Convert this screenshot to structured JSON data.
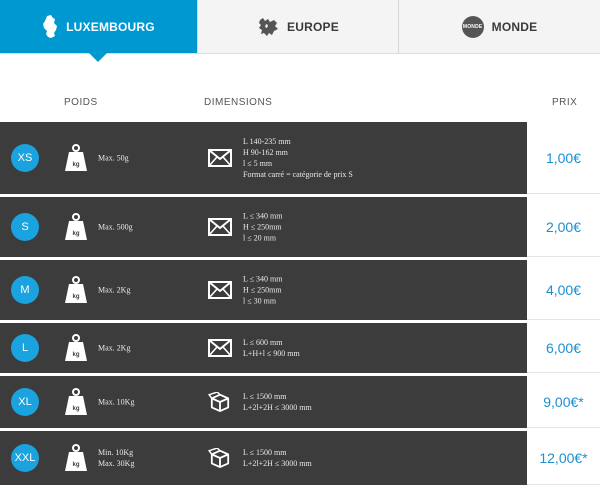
{
  "tabs": [
    {
      "label": "LUXEMBOURG",
      "active": true,
      "icon": "luxembourg-map-icon"
    },
    {
      "label": "EUROPE",
      "active": false,
      "icon": "europe-map-icon"
    },
    {
      "label": "MONDE",
      "active": false,
      "icon": "monde-badge-icon",
      "badge": "MONDE"
    }
  ],
  "columns": {
    "poids": "POIDS",
    "dimensions": "DIMENSIONS",
    "prix": "PRIX"
  },
  "weight_icon_text": "kg",
  "colors": {
    "accent": "#0098d1",
    "badge": "#1aa3de",
    "row_bg": "#3c3c3c",
    "price": "#1b8fd0"
  },
  "rows": [
    {
      "size": "XS",
      "weight": [
        "Max. 50g"
      ],
      "dim_icon": "envelope-icon",
      "dims": [
        "L 140-235 mm",
        "H 90-162 mm",
        "l ≤ 5 mm",
        "Format carré = catégorie de prix S"
      ],
      "price": "1,00€"
    },
    {
      "size": "S",
      "weight": [
        "Max. 500g"
      ],
      "dim_icon": "envelope-icon",
      "dims": [
        "L ≤ 340 mm",
        "H ≤ 250mm",
        "l ≤ 20 mm"
      ],
      "price": "2,00€"
    },
    {
      "size": "M",
      "weight": [
        "Max. 2Kg"
      ],
      "dim_icon": "envelope-icon",
      "dims": [
        "L ≤ 340 mm",
        "H ≤ 250mm",
        "l ≤ 30 mm"
      ],
      "price": "4,00€"
    },
    {
      "size": "L",
      "weight": [
        "Max. 2Kg"
      ],
      "dim_icon": "envelope-icon",
      "dims": [
        "L ≤ 600 mm",
        "L+H+l ≤ 900 mm"
      ],
      "price": "6,00€"
    },
    {
      "size": "XL",
      "weight": [
        "Max. 10Kg"
      ],
      "dim_icon": "package-icon",
      "dims": [
        "L ≤ 1500 mm",
        "L+2l+2H ≤ 3000 mm"
      ],
      "price": "9,00€*"
    },
    {
      "size": "XXL",
      "weight": [
        "Min. 10Kg",
        "Max. 30Kg"
      ],
      "dim_icon": "package-icon",
      "dims": [
        "L ≤ 1500 mm",
        "L+2l+2H ≤ 3000 mm"
      ],
      "price": "12,00€*"
    }
  ]
}
